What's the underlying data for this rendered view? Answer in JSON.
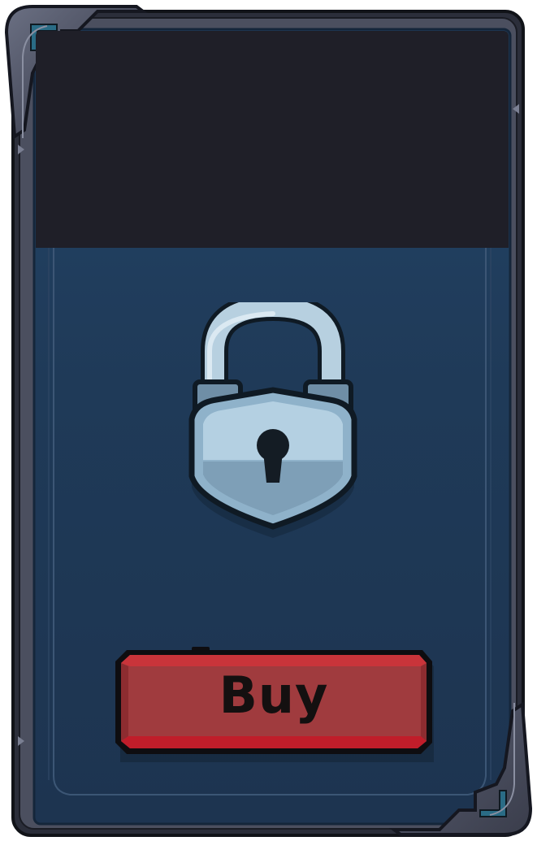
{
  "card": {
    "state": "locked",
    "icon": "padlock-icon",
    "buy_label": "Buy"
  },
  "colors": {
    "frame_outer": "#4a4e5e",
    "frame_inner": "#2a2f3d",
    "panel_bg": "#1f3651",
    "header_bg": "#1f1f28",
    "button_red": "#a23b3d",
    "lock_body": "#9fc1d8",
    "lock_shackle": "#b9d2e2"
  }
}
